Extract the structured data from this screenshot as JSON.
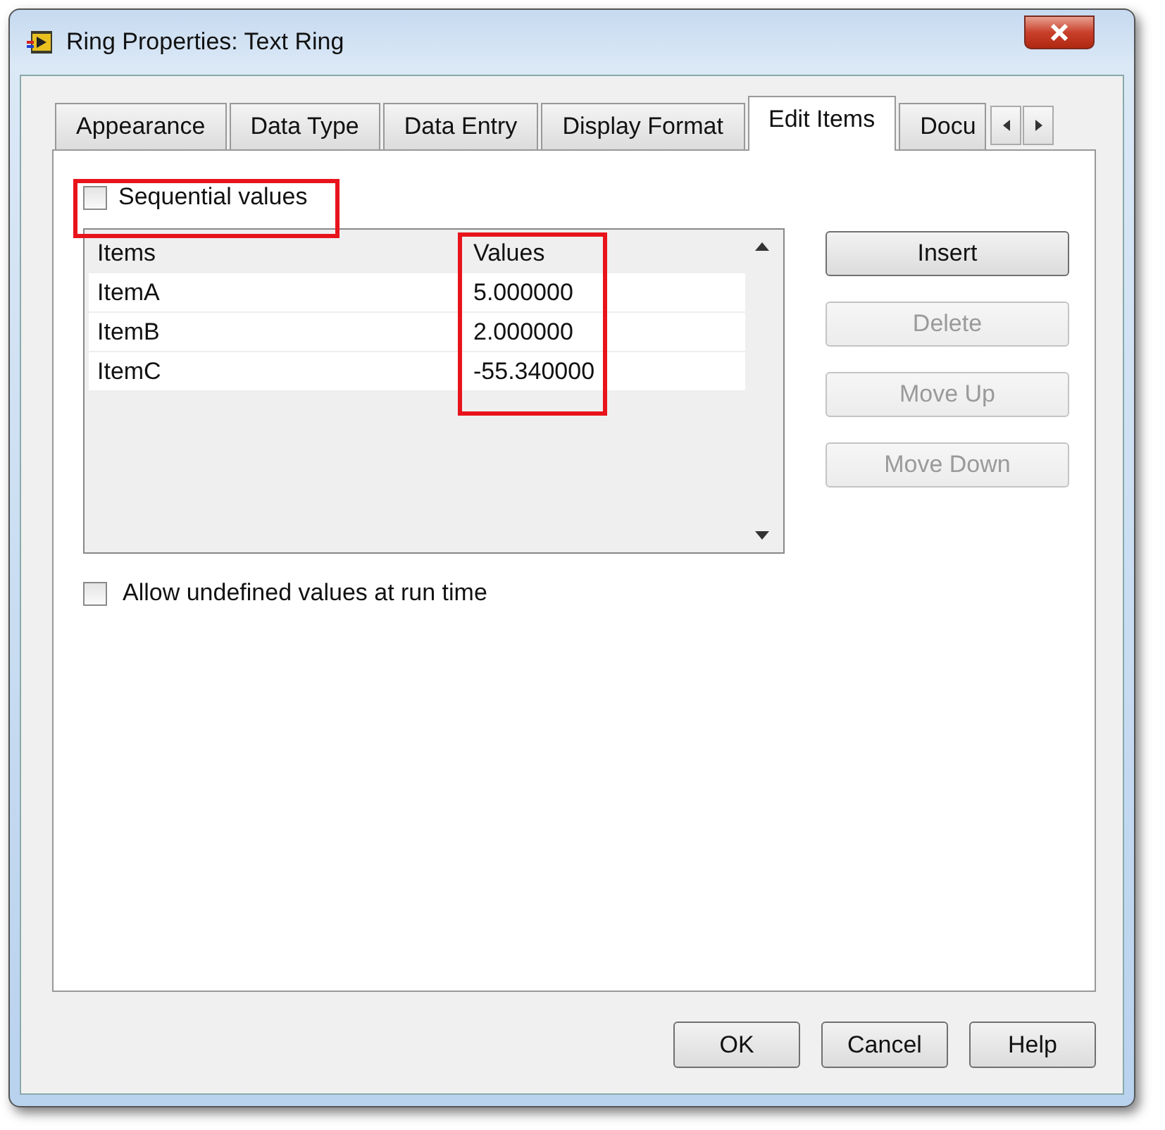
{
  "window": {
    "title": "Ring Properties: Text Ring"
  },
  "tabs": [
    {
      "label": "Appearance",
      "selected": false
    },
    {
      "label": "Data Type",
      "selected": false
    },
    {
      "label": "Data Entry",
      "selected": false
    },
    {
      "label": "Display Format",
      "selected": false
    },
    {
      "label": "Edit Items",
      "selected": true
    },
    {
      "label": "Docu",
      "selected": false
    }
  ],
  "sequential_values": {
    "label": "Sequential values",
    "checked": false
  },
  "items_table": {
    "columns": [
      "Items",
      "Values"
    ],
    "rows": [
      [
        "ItemA",
        "5.000000"
      ],
      [
        "ItemB",
        "2.000000"
      ],
      [
        "ItemC",
        "-55.340000"
      ]
    ]
  },
  "side_buttons": [
    {
      "label": "Insert",
      "disabled": false
    },
    {
      "label": "Delete",
      "disabled": true
    },
    {
      "label": "Move Up",
      "disabled": true
    },
    {
      "label": "Move Down",
      "disabled": true
    }
  ],
  "allow_undefined": {
    "label": "Allow undefined values at run time",
    "checked": false
  },
  "buttons": [
    "OK",
    "Cancel",
    "Help"
  ]
}
